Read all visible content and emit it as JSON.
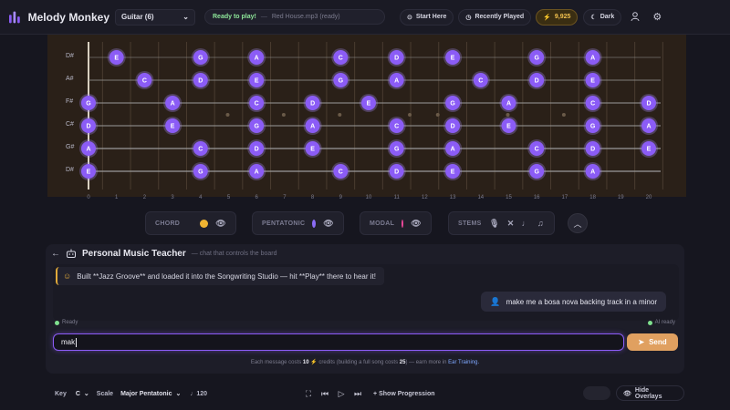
{
  "app": {
    "name": "Melody Monkey"
  },
  "header": {
    "instrument": "Guitar (6)",
    "status_ready": "Ready to play!",
    "status_sep": "—",
    "status_file": "Red House.mp3 (ready)",
    "start_here": "Start Here",
    "recently_played": "Recently Played",
    "credits": "9,925",
    "theme": "Dark",
    "colors": {
      "accent": "#8b5cf6",
      "credits": "#f2c14e"
    }
  },
  "fretboard": {
    "strings": [
      "D#",
      "A#",
      "F#",
      "C#",
      "G#",
      "D#"
    ],
    "fret_numbers": [
      "0",
      "1",
      "2",
      "3",
      "4",
      "5",
      "6",
      "7",
      "8",
      "9",
      "10",
      "11",
      "12",
      "13",
      "14",
      "15",
      "16",
      "17",
      "18",
      "19",
      "20"
    ],
    "notes": [
      {
        "s": 0,
        "f": 1,
        "label": "E"
      },
      {
        "s": 0,
        "f": 4,
        "label": "G"
      },
      {
        "s": 0,
        "f": 6,
        "label": "A"
      },
      {
        "s": 0,
        "f": 9,
        "label": "C"
      },
      {
        "s": 0,
        "f": 11,
        "label": "D"
      },
      {
        "s": 0,
        "f": 13,
        "label": "E"
      },
      {
        "s": 0,
        "f": 16,
        "label": "G"
      },
      {
        "s": 0,
        "f": 18,
        "label": "A"
      },
      {
        "s": 1,
        "f": 2,
        "label": "C"
      },
      {
        "s": 1,
        "f": 4,
        "label": "D"
      },
      {
        "s": 1,
        "f": 6,
        "label": "E"
      },
      {
        "s": 1,
        "f": 9,
        "label": "G"
      },
      {
        "s": 1,
        "f": 11,
        "label": "A"
      },
      {
        "s": 1,
        "f": 14,
        "label": "C"
      },
      {
        "s": 1,
        "f": 16,
        "label": "D"
      },
      {
        "s": 1,
        "f": 18,
        "label": "E"
      },
      {
        "s": 2,
        "f": 0,
        "label": "G"
      },
      {
        "s": 2,
        "f": 3,
        "label": "A"
      },
      {
        "s": 2,
        "f": 6,
        "label": "C"
      },
      {
        "s": 2,
        "f": 8,
        "label": "D"
      },
      {
        "s": 2,
        "f": 10,
        "label": "E"
      },
      {
        "s": 2,
        "f": 13,
        "label": "G"
      },
      {
        "s": 2,
        "f": 15,
        "label": "A"
      },
      {
        "s": 2,
        "f": 18,
        "label": "C"
      },
      {
        "s": 2,
        "f": 20,
        "label": "D"
      },
      {
        "s": 3,
        "f": 0,
        "label": "D"
      },
      {
        "s": 3,
        "f": 3,
        "label": "E"
      },
      {
        "s": 3,
        "f": 6,
        "label": "G"
      },
      {
        "s": 3,
        "f": 8,
        "label": "A"
      },
      {
        "s": 3,
        "f": 11,
        "label": "C"
      },
      {
        "s": 3,
        "f": 13,
        "label": "D"
      },
      {
        "s": 3,
        "f": 15,
        "label": "E"
      },
      {
        "s": 3,
        "f": 18,
        "label": "G"
      },
      {
        "s": 3,
        "f": 20,
        "label": "A"
      },
      {
        "s": 4,
        "f": 0,
        "label": "A"
      },
      {
        "s": 4,
        "f": 4,
        "label": "C"
      },
      {
        "s": 4,
        "f": 6,
        "label": "D"
      },
      {
        "s": 4,
        "f": 8,
        "label": "E"
      },
      {
        "s": 4,
        "f": 11,
        "label": "G"
      },
      {
        "s": 4,
        "f": 13,
        "label": "A"
      },
      {
        "s": 4,
        "f": 16,
        "label": "C"
      },
      {
        "s": 4,
        "f": 18,
        "label": "D"
      },
      {
        "s": 4,
        "f": 20,
        "label": "E"
      },
      {
        "s": 5,
        "f": 0,
        "label": "E"
      },
      {
        "s": 5,
        "f": 4,
        "label": "G"
      },
      {
        "s": 5,
        "f": 6,
        "label": "A"
      },
      {
        "s": 5,
        "f": 9,
        "label": "C"
      },
      {
        "s": 5,
        "f": 11,
        "label": "D"
      },
      {
        "s": 5,
        "f": 13,
        "label": "E"
      },
      {
        "s": 5,
        "f": 16,
        "label": "G"
      },
      {
        "s": 5,
        "f": 18,
        "label": "A"
      }
    ],
    "colors": {
      "note_fill": "#8b5cf6",
      "note_glow": "#a78bfa"
    }
  },
  "toggles": {
    "chord": {
      "label": "CHORD",
      "color": "#f0b432"
    },
    "pentatonic": {
      "label": "PENTATONIC",
      "color": "#8b6cf6"
    },
    "modal": {
      "label": "MODAL",
      "color": "#ec4899"
    },
    "stems": {
      "label": "STEMS"
    }
  },
  "teacher": {
    "title": "Personal Music Teacher",
    "subtitle": "— chat that controls the board",
    "bot_message": "Built **Jazz Groove** and loaded it into the Songwriting Studio — hit **Play** there to hear it!",
    "user_message": "make me a bosa nova backing track in a minor",
    "status_left": "Ready",
    "status_right": "AI ready",
    "input_value": "mak",
    "send_label": "Send",
    "cost_prefix": "Each message costs",
    "cost_amount": "10",
    "cost_mid": "credits (building a full song costs",
    "cost_song": "25",
    "cost_suffix": ") — earn more in",
    "cost_link": "Ear Training."
  },
  "bottom": {
    "key_label": "Key",
    "key_value": "C",
    "scale_label": "Scale",
    "scale_value": "Major Pentatonic",
    "tempo": "♩120",
    "show_progression": "Show Progression",
    "hide_overlays": "Hide Overlays"
  }
}
